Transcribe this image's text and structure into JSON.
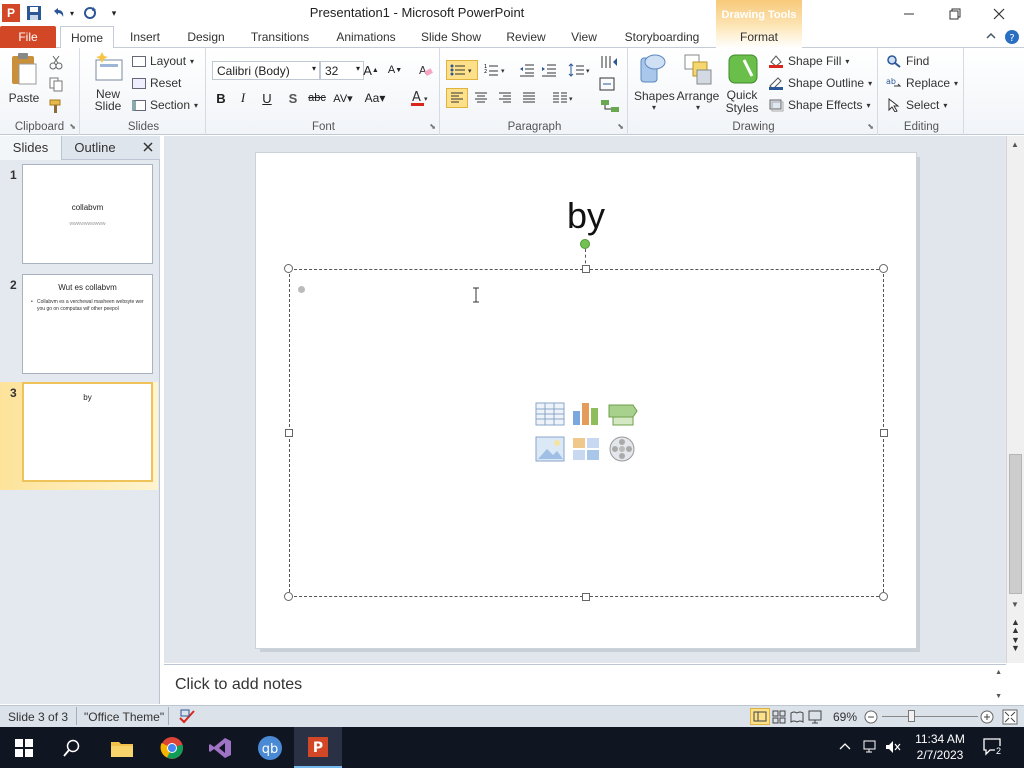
{
  "window": {
    "title": "Presentation1  -  Microsoft PowerPoint",
    "contextual_tab_group": "Drawing Tools",
    "app_letter": "P"
  },
  "tabs": [
    "File",
    "Home",
    "Insert",
    "Design",
    "Transitions",
    "Animations",
    "Slide Show",
    "Review",
    "View",
    "Storyboarding",
    "Format"
  ],
  "ribbon": {
    "clipboard": {
      "label": "Clipboard",
      "paste": "Paste"
    },
    "slides": {
      "label": "Slides",
      "new_slide": "New Slide",
      "layout": "Layout",
      "reset": "Reset",
      "section": "Section"
    },
    "font": {
      "label": "Font",
      "font_name": "Calibri (Body)",
      "font_size": "32"
    },
    "paragraph": {
      "label": "Paragraph"
    },
    "drawing": {
      "label": "Drawing",
      "shapes": "Shapes",
      "arrange": "Arrange",
      "quick_styles": "Quick Styles",
      "shape_fill": "Shape Fill",
      "shape_outline": "Shape Outline",
      "shape_effects": "Shape Effects"
    },
    "editing": {
      "label": "Editing",
      "find": "Find",
      "replace": "Replace",
      "select": "Select"
    }
  },
  "panel": {
    "tabs": [
      "Slides",
      "Outline"
    ],
    "slides": [
      {
        "num": "1",
        "title": "collabvm",
        "subtitle": "wwwwwwwwww"
      },
      {
        "num": "2",
        "title": "Wut es collabvm",
        "bullet": "Collabvm es a verchewal masheen websyte wer you go on  computas wif other peepol"
      },
      {
        "num": "3",
        "title": "by"
      }
    ]
  },
  "slide": {
    "title": "by"
  },
  "notes": {
    "placeholder": "Click to add notes"
  },
  "status": {
    "slide_info": "Slide 3 of 3",
    "theme": "\"Office Theme\"",
    "zoom": "69%"
  },
  "taskbar": {
    "time": "11:34 AM",
    "date": "2/7/2023",
    "notifications": "2"
  },
  "colors": {
    "file_tab": "#d24726",
    "accent_selected": "#fde08a",
    "taskbar": "#101522"
  }
}
